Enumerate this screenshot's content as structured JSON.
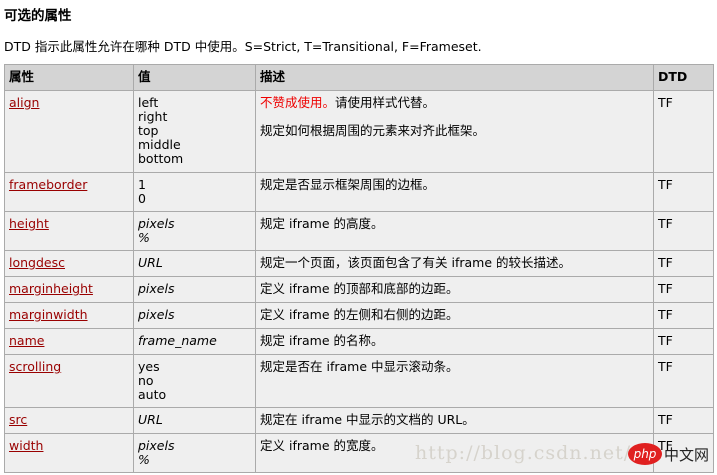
{
  "heading": "可选的属性",
  "intro": "DTD 指示此属性允许在哪种 DTD 中使用。S=Strict, T=Transitional, F=Frameset.",
  "table": {
    "headers": [
      "属性",
      "值",
      "描述",
      "DTD"
    ],
    "rows": [
      {
        "attr": "align",
        "values": [
          "left",
          "right",
          "top",
          "middle",
          "bottom"
        ],
        "italic": false,
        "deprecated": "不赞成使用。",
        "desc": "请使用样式代替。",
        "desc2": "规定如何根据周围的元素来对齐此框架。",
        "dtd": "TF",
        "height": 82
      },
      {
        "attr": "frameborder",
        "values": [
          "1",
          "0"
        ],
        "italic": false,
        "desc": "规定是否显示框架周围的边框。",
        "dtd": "TF",
        "height": 39
      },
      {
        "attr": "height",
        "values": [
          "pixels",
          "%"
        ],
        "italic": true,
        "desc": "规定 iframe 的高度。",
        "dtd": "TF",
        "height": 39
      },
      {
        "attr": "longdesc",
        "values": [
          "URL"
        ],
        "italic": true,
        "desc": "规定一个页面，该页面包含了有关 iframe 的较长描述。",
        "dtd": "TF",
        "height": 26
      },
      {
        "attr": "marginheight",
        "values": [
          "pixels"
        ],
        "italic": true,
        "desc": "定义 iframe 的顶部和底部的边距。",
        "dtd": "TF",
        "height": 26
      },
      {
        "attr": "marginwidth",
        "values": [
          "pixels"
        ],
        "italic": true,
        "desc": "定义 iframe 的左侧和右侧的边距。",
        "dtd": "TF",
        "height": 26
      },
      {
        "attr": "name",
        "values": [
          "frame_name"
        ],
        "italic": true,
        "desc": "规定 iframe 的名称。",
        "dtd": "TF",
        "height": 26
      },
      {
        "attr": "scrolling",
        "values": [
          "yes",
          "no",
          "auto"
        ],
        "italic": false,
        "desc": "规定是否在 iframe 中显示滚动条。",
        "dtd": "TF",
        "height": 53
      },
      {
        "attr": "src",
        "values": [
          "URL"
        ],
        "italic": true,
        "desc": "规定在 iframe 中显示的文档的 URL。",
        "dtd": "TF",
        "height": 26
      },
      {
        "attr": "width",
        "values": [
          "pixels",
          "%"
        ],
        "italic": true,
        "desc": "定义 iframe 的宽度。",
        "dtd": "TF",
        "height": 39
      }
    ]
  },
  "watermark": "http://blog.csdn.net/",
  "logo": {
    "php": "php",
    "cn": "中文网"
  },
  "colors": {
    "link": "#990000",
    "deprecated": "#ee0000",
    "header_bg": "#d4d4d4",
    "cell_bg": "#efefef"
  }
}
